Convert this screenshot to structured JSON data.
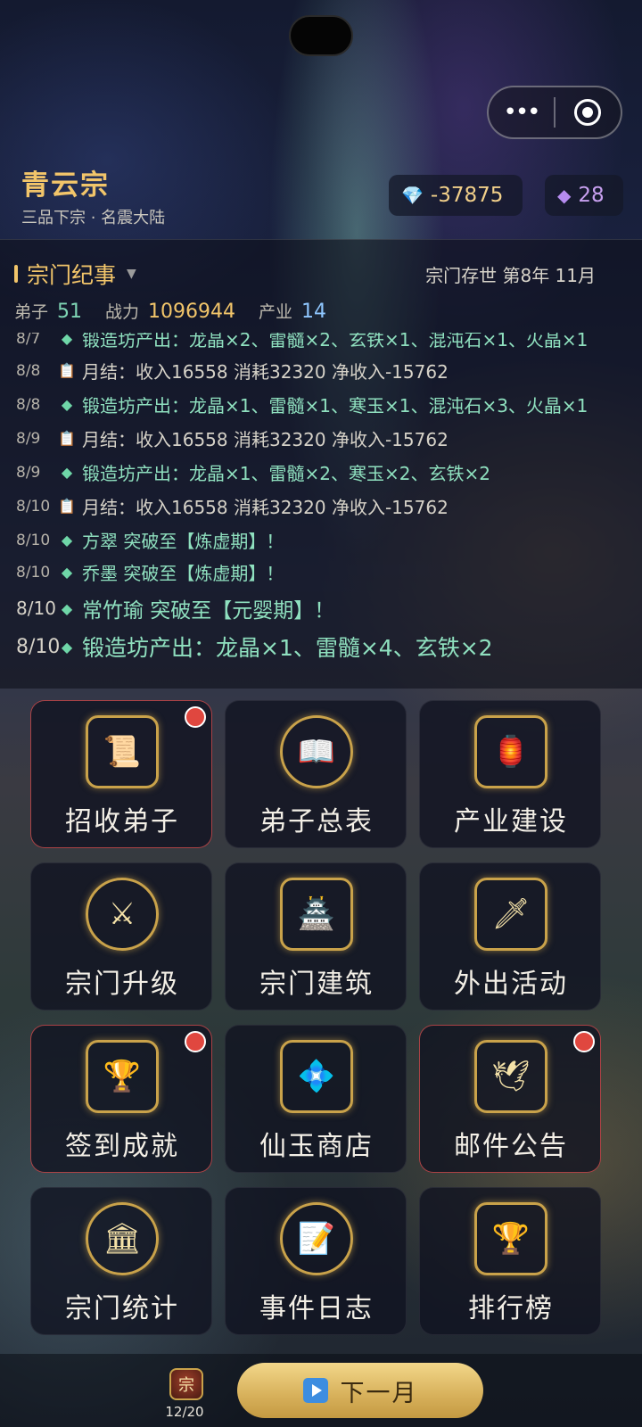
{
  "menu": {
    "more_icon": "more-dots-icon",
    "close_icon": "target-icon",
    "more_glyph": "•••"
  },
  "sect": {
    "name": "青云宗",
    "subtitle": "三品下宗 · 名震大陆"
  },
  "resources": {
    "gems": {
      "icon": "diamond-icon",
      "glyph": "💎",
      "value": "-37875"
    },
    "jade": {
      "icon": "purple-gem-icon",
      "glyph": "◆",
      "value": "28"
    }
  },
  "chronicle": {
    "title": "宗门纪事",
    "caret": "▼",
    "time": "宗门存世 第8年 11月",
    "stats": [
      {
        "label": "弟子",
        "value": "51"
      },
      {
        "label": "战力",
        "value": "1096944"
      },
      {
        "label": "产业",
        "value": "14"
      }
    ],
    "entries": [
      {
        "date": "8/7",
        "icon": "◆",
        "text": "锻造坊产出：龙晶×2、雷髓×2、玄铁×1、混沌石×1、火晶×1"
      },
      {
        "date": "8/8",
        "icon": "📋",
        "text": "月结：收入16558 消耗32320 净收入-15762"
      },
      {
        "date": "8/8",
        "icon": "◆",
        "text": "锻造坊产出：龙晶×1、雷髓×1、寒玉×1、混沌石×3、火晶×1"
      },
      {
        "date": "8/9",
        "icon": "📋",
        "text": "月结：收入16558 消耗32320 净收入-15762"
      },
      {
        "date": "8/9",
        "icon": "◆",
        "text": "锻造坊产出：龙晶×1、雷髓×2、寒玉×2、玄铁×2"
      },
      {
        "date": "8/10",
        "icon": "📋",
        "text": "月结：收入16558 消耗32320 净收入-15762"
      },
      {
        "date": "8/10",
        "icon": "◆",
        "text": "方翠 突破至【炼虚期】！"
      },
      {
        "date": "8/10",
        "icon": "◆",
        "text": "乔墨 突破至【炼虚期】！"
      },
      {
        "date": "8/10",
        "icon": "◆",
        "text": "常竹瑜 突破至【元婴期】！"
      },
      {
        "date": "8/10",
        "icon": "◆",
        "text": "锻造坊产出：龙晶×1、雷髓×4、玄铁×2"
      }
    ]
  },
  "actions": [
    {
      "label": "招收弟子",
      "icon": "recruit-scroll-icon",
      "glyph": "📜",
      "alert": true
    },
    {
      "label": "弟子总表",
      "icon": "disciple-book-icon",
      "glyph": "📖",
      "alert": false
    },
    {
      "label": "产业建设",
      "icon": "industry-cauldron-icon",
      "glyph": "🏮",
      "alert": false
    },
    {
      "label": "宗门升级",
      "icon": "sect-upgrade-icon",
      "glyph": "⚔",
      "alert": false
    },
    {
      "label": "宗门建筑",
      "icon": "sect-building-icon",
      "glyph": "🏯",
      "alert": false
    },
    {
      "label": "外出活动",
      "icon": "outing-sword-icon",
      "glyph": "🗡",
      "alert": false
    },
    {
      "label": "签到成就",
      "icon": "checkin-chest-icon",
      "glyph": "🏆",
      "alert": true
    },
    {
      "label": "仙玉商店",
      "icon": "jade-shop-icon",
      "glyph": "💠",
      "alert": false
    },
    {
      "label": "邮件公告",
      "icon": "mail-bird-icon",
      "glyph": "🕊",
      "alert": true
    },
    {
      "label": "宗门统计",
      "icon": "sect-stats-icon",
      "glyph": "🏛",
      "alert": false
    },
    {
      "label": "事件日志",
      "icon": "event-log-icon",
      "glyph": "📝",
      "alert": false
    },
    {
      "label": "排行榜",
      "icon": "leaderboard-trophy-icon",
      "glyph": "🏆",
      "alert": false
    }
  ],
  "footer": {
    "badge_icon": "sect-emblem-icon",
    "badge_glyph": "宗",
    "badge_count": "12/20",
    "next_label": "下一月"
  }
}
